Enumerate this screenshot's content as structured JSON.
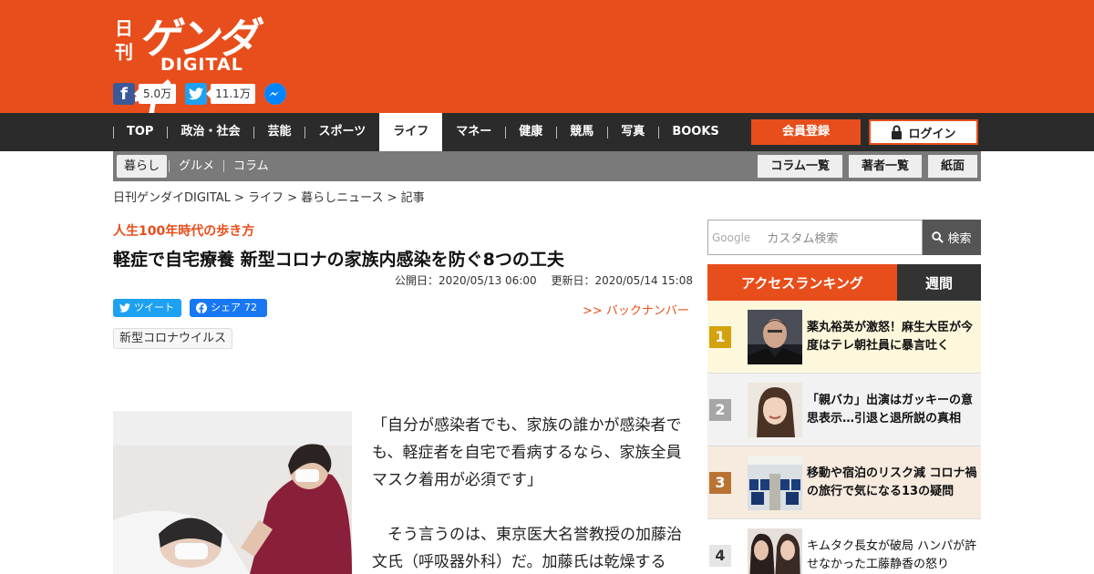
{
  "logo": {
    "nikkan": "日刊",
    "name": "ゲンダイ",
    "sub": "DIGITAL"
  },
  "social": {
    "facebook_count": "5.0万",
    "twitter_count": "11.1万"
  },
  "nav": {
    "items": [
      "TOP",
      "政治・社会",
      "芸能",
      "スポーツ",
      "ライフ",
      "マネー",
      "健康",
      "競馬",
      "写真",
      "BOOKS"
    ],
    "active": "ライフ",
    "register": "会員登録",
    "login": "ログイン"
  },
  "subnav": {
    "items": [
      "暮らし",
      "グルメ",
      "コラム"
    ],
    "buttons": [
      "コラム一覧",
      "著者一覧",
      "紙面"
    ]
  },
  "breadcrumb": "日刊ゲンダイDIGITAL > ライフ > 暮らしニュース > 記事",
  "article": {
    "kicker": "人生100年時代の歩き方",
    "title": "軽症で自宅療養 新型コロナの家族内感染を防ぐ8つの工夫",
    "published": "公開日：2020/05/13 06:00",
    "updated": "更新日：2020/05/14 15:08",
    "tweet_label": "ツイート",
    "share_label": "シェア",
    "share_count": "72",
    "backnumber": ">> バックナンバー",
    "tag": "新型コロナウイルス",
    "para1": "「自分が感染者でも、家族の誰かが感染者でも、軽症者を自宅で看病するなら、家族全員マスク着用が必須です」",
    "para2": "　そう言うのは、東京医大名誉教授の加藤治文氏（呼吸器外科）だ。加藤氏は乾燥する"
  },
  "sidebar": {
    "search_logo": "Google",
    "search_placeholder": "カスタム検索",
    "search_button": "検索",
    "ranking_tab": "アクセスランキング",
    "ranking_period": "週間",
    "ranking": [
      {
        "rank": "1",
        "title": "薬丸裕英が激怒！麻生大臣が今度はテレ朝社員に暴言吐く"
      },
      {
        "rank": "2",
        "title": "「親バカ」出演はガッキーの意思表示…引退と退所説の真相"
      },
      {
        "rank": "3",
        "title": "移動や宿泊のリスク減 コロナ禍の旅行で気になる13の疑問"
      },
      {
        "rank": "4",
        "title": "キムタク長女が破局 ハンパが許せなかった工藤静香の怒り"
      }
    ]
  },
  "colors": {
    "brand": "#e84e1b",
    "nav_bg": "#2b2b2b",
    "subnav_bg": "#7a7a7a"
  }
}
